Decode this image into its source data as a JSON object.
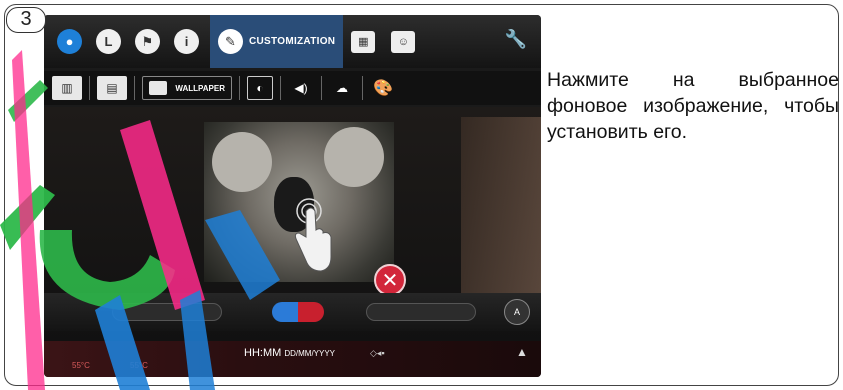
{
  "step": {
    "number": "3"
  },
  "topbar": {
    "customization_label": "CUSTOMIZATION",
    "icons": [
      "water-drop-icon",
      "clock-icon",
      "flag-icon",
      "info-icon",
      "pencil-icon",
      "calendar-icon",
      "user-icon",
      "wrench-icon"
    ]
  },
  "subbar": {
    "wallpaper_label": "WALLPAPER"
  },
  "statusbar": {
    "time": "HH:MM",
    "date": "DD/MM/YYYY",
    "temp_1": "55°C",
    "temp_2": "55°C"
  },
  "controls": {
    "ab_label": "A"
  },
  "instruction": {
    "text": "Нажмите на выбранное фоновое изображение, чтобы установить его."
  },
  "colors": {
    "accent_blue": "#2a4d78",
    "delete_red": "#d2263a",
    "watermark_green": "#2db84a",
    "watermark_pink": "#ff2a8c",
    "watermark_blue": "#1f7fd6"
  }
}
